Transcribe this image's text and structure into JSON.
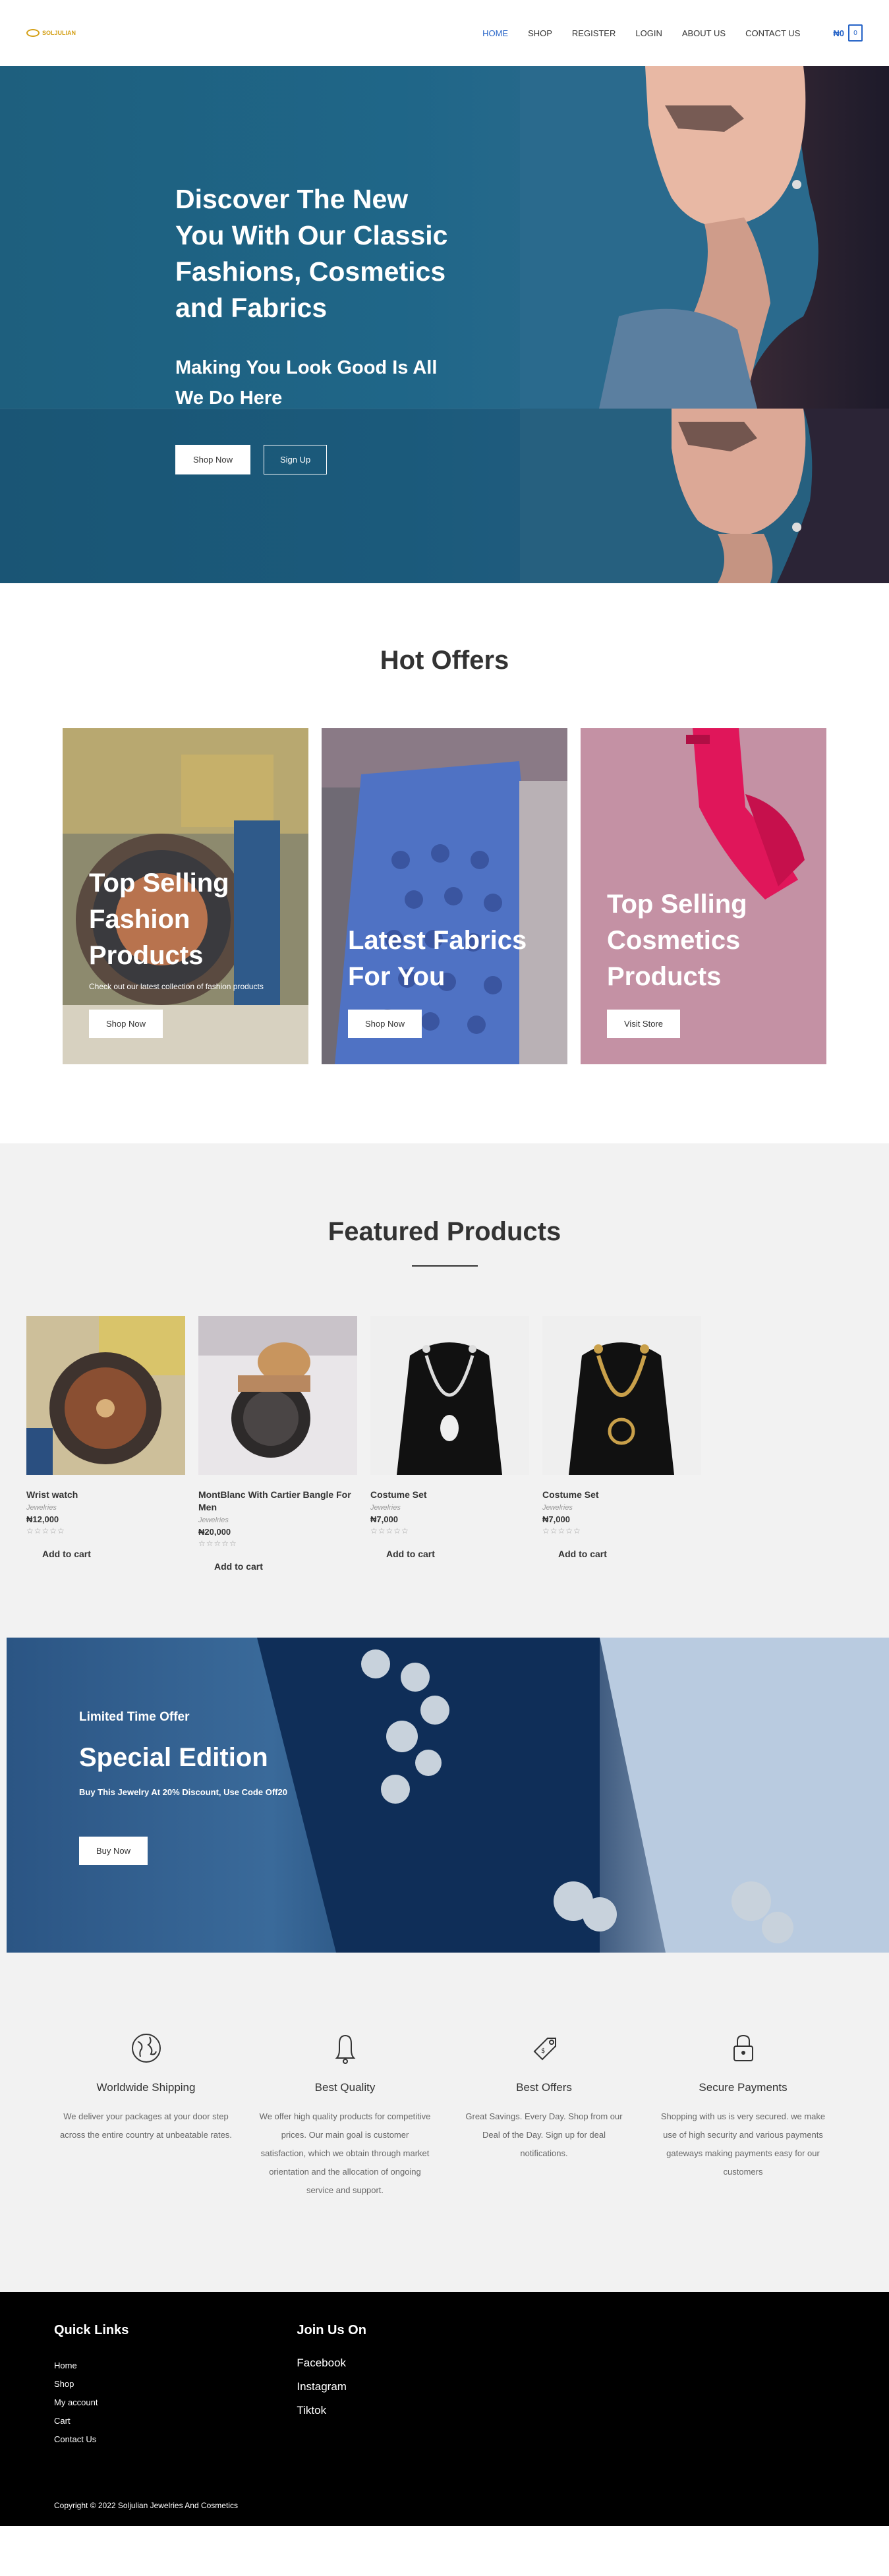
{
  "header": {
    "logo_text": "SOLJULIAN",
    "nav": [
      {
        "label": "HOME",
        "active": true
      },
      {
        "label": "SHOP"
      },
      {
        "label": "REGISTER"
      },
      {
        "label": "LOGIN"
      },
      {
        "label": "ABOUT US"
      },
      {
        "label": "CONTACT US"
      }
    ],
    "cart_amount": "₦0",
    "cart_count": "0",
    "accent": "#2563c7"
  },
  "hero": {
    "title": "Discover The New You With Our Classic Fashions, Cosmetics and Fabrics",
    "subtitle": "Making You Look Good Is All We Do Here",
    "shop_btn": "Shop Now",
    "signup_btn": "Sign Up"
  },
  "hot_offers": {
    "title": "Hot Offers",
    "cards": [
      {
        "title": "Top Selling Fashion Products",
        "desc": "Check out our latest collection of fashion products",
        "btn": "Shop Now"
      },
      {
        "title": "Latest Fabrics For You",
        "btn": "Shop Now"
      },
      {
        "title": "Top Selling Cosmetics Products",
        "btn": "Visit Store"
      }
    ]
  },
  "featured": {
    "title": "Featured Products",
    "products": [
      {
        "name": "Wrist watch",
        "category": "Jewelries",
        "price": "₦12,000",
        "stars": "☆☆☆☆☆",
        "add": "Add to cart"
      },
      {
        "name": "MontBlanc With Cartier Bangle For Men",
        "category": "Jewelries",
        "price": "₦20,000",
        "stars": "☆☆☆☆☆",
        "add": "Add to cart"
      },
      {
        "name": "Costume Set",
        "category": "Jewelries",
        "price": "₦7,000",
        "stars": "☆☆☆☆☆",
        "add": "Add to cart"
      },
      {
        "name": "Costume Set",
        "category": "Jewelries",
        "price": "₦7,000",
        "stars": "☆☆☆☆☆",
        "add": "Add to cart"
      }
    ]
  },
  "special": {
    "kicker": "Limited Time Offer",
    "title": "Special Edition",
    "desc": "Buy This Jewelry At 20% Discount, Use Code Off20",
    "btn": "Buy Now"
  },
  "features": [
    {
      "icon": "globe-icon",
      "title": "Worldwide Shipping",
      "text": "We deliver your packages at your door step across the entire country at unbeatable rates."
    },
    {
      "icon": "bell-icon",
      "title": "Best Quality",
      "text": "We offer high quality products for competitive prices. Our main goal is customer satisfaction, which we obtain through market orientation and the allocation of ongoing service and support."
    },
    {
      "icon": "tag-icon",
      "title": "Best Offers",
      "text": "Great Savings. Every Day. Shop from our Deal of the Day. Sign up for deal notifications."
    },
    {
      "icon": "lock-icon",
      "title": "Secure Payments",
      "text": "Shopping with us is very secured. we make use of high security and various payments gateways making payments easy for our customers"
    }
  ],
  "footer": {
    "quick_links_title": "Quick Links",
    "quick_links": [
      "Home",
      "Shop",
      "My account",
      "Cart",
      "Contact Us"
    ],
    "join_title": "Join Us On",
    "social": [
      "Facebook",
      "Instagram",
      "Tiktok"
    ],
    "copyright": "Copyright © 2022 Soljulian Jewelries And Cosmetics"
  }
}
